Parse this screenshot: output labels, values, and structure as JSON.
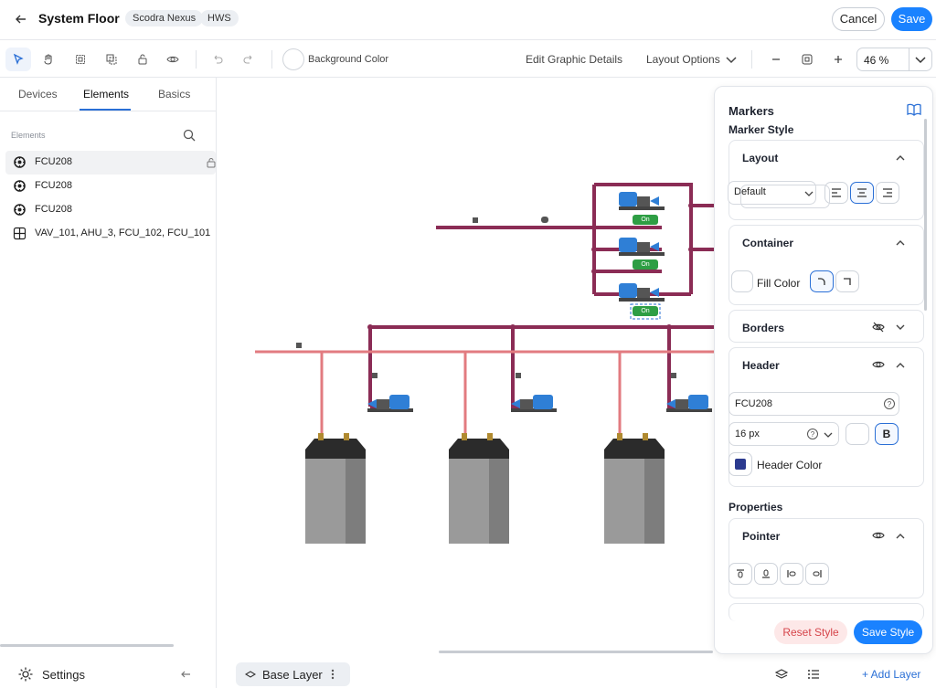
{
  "header": {
    "title": "System Floor",
    "tags": [
      "Scodra Nexus",
      "HWS"
    ],
    "cancel_label": "Cancel",
    "save_label": "Save"
  },
  "toolbar": {
    "background_color_label": "Background Color",
    "edit_details_label": "Edit Graphic Details",
    "layout_options_label": "Layout Options",
    "zoom_value": "46 %"
  },
  "left_panel": {
    "tabs": [
      "Devices",
      "Elements",
      "Basics"
    ],
    "active_tab": "Elements",
    "section_label": "Elements",
    "items": [
      {
        "label": "FCU208",
        "icon": "fan-icon"
      },
      {
        "label": "FCU208",
        "icon": "fan-icon"
      },
      {
        "label": "FCU208",
        "icon": "fan-icon"
      },
      {
        "label": "VAV_101, AHU_3, FCU_102, FCU_101",
        "icon": "grid-icon"
      }
    ],
    "settings_label": "Settings"
  },
  "canvas": {
    "status_badges": [
      "On",
      "On",
      "On"
    ]
  },
  "markers_panel": {
    "title": "Markers",
    "marker_style_label": "Marker Style",
    "layout": {
      "title": "Layout",
      "select_value": "Default"
    },
    "container": {
      "title": "Container",
      "fill_color_label": "Fill Color"
    },
    "borders": {
      "title": "Borders"
    },
    "header": {
      "title": "Header",
      "text_value": "FCU208",
      "font_size": "16 px",
      "bold_label": "B",
      "color_label": "Header Color",
      "color": "#2b3a8f"
    },
    "properties_label": "Properties",
    "pointer": {
      "title": "Pointer"
    },
    "reset_label": "Reset Style",
    "save_style_label": "Save Style"
  },
  "bottom_bar": {
    "layer_label": "Base Layer",
    "add_layer_label": "+ Add Layer"
  },
  "colors": {
    "accent": "#1a82ff",
    "pipe_dark": "#8b2c55",
    "pipe_light": "#e27b80",
    "status_green": "#2e9e44"
  }
}
